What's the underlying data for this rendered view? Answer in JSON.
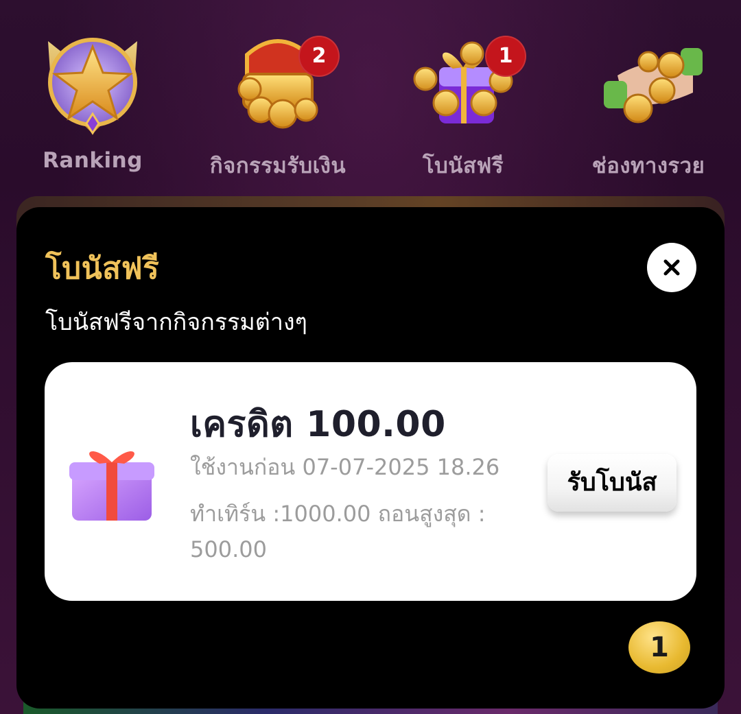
{
  "nav": {
    "items": [
      {
        "label": "Ranking",
        "icon": "star-trophy-icon",
        "badge": ""
      },
      {
        "label": "กิจกรรมรับเงิน",
        "icon": "treasure-chest-icon",
        "badge": "2"
      },
      {
        "label": "โบนัสฟรี",
        "icon": "gift-box-coins-icon",
        "badge": "1"
      },
      {
        "label": "ช่องทางรวย",
        "icon": "coin-hand-icon",
        "badge": ""
      }
    ]
  },
  "modal": {
    "title": "โบนัสฟรี",
    "subtitle": "โบนัสฟรีจากกิจกรรมต่างๆ",
    "close_icon": "close-icon",
    "card": {
      "amount": "เครดิต 100.00",
      "expires": "ใช้งานก่อน 07-07-2025 18.26",
      "turnover_line1": "ทำเทิร์น :1000.00 ถอนสูงสุด :",
      "turnover_line2": "500.00",
      "claim_label": "รับโบนัส",
      "gift_icon": "gift-icon"
    },
    "page_indicator": "1"
  },
  "colors": {
    "title_gold": "#f0c25a",
    "badge_red": "#c4151c",
    "page_gold": "#e8b930"
  }
}
